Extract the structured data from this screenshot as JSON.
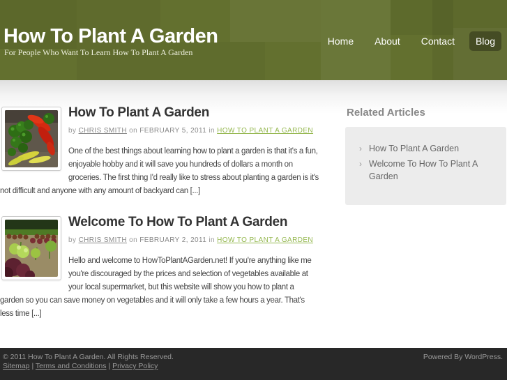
{
  "header": {
    "title": "How To Plant A Garden",
    "tagline": "For People Who Want To Learn How To Plant A Garden",
    "nav": [
      {
        "label": "Home",
        "active": false
      },
      {
        "label": "About",
        "active": false
      },
      {
        "label": "Contact",
        "active": false
      },
      {
        "label": "Blog",
        "active": true
      }
    ]
  },
  "posts": [
    {
      "title": "How To Plant A Garden",
      "thumbnail_name": "peppers-photo",
      "byline": {
        "by": "by",
        "author": "CHRIS SMITH",
        "on": "on",
        "date": "FEBRUARY 5, 2011",
        "in": "in",
        "category": "HOW TO PLANT A GARDEN"
      },
      "excerpt": "One of the best things about learning how to plant a garden is that it's a fun, enjoyable hobby and it will save you hundreds of dollars a month on groceries. The first thing I'd really like to stress about planting a garden is it's not difficult and anyone with any amount of backyard can [...]"
    },
    {
      "title": "Welcome To How To Plant A Garden",
      "thumbnail_name": "garden-rows-photo",
      "byline": {
        "by": "by",
        "author": "CHRIS SMITH",
        "on": "on",
        "date": "FEBRUARY 2, 2011",
        "in": "in",
        "category": "HOW TO PLANT A GARDEN"
      },
      "excerpt": "Hello and welcome to HowToPlantAGarden.net! If you're anything like me you're discouraged by the prices and selection of vegetables available at your local supermarket, but this website will show you how to plant a garden so you can save money on vegetables and it will only take a few hours a year. That's less time [...]"
    }
  ],
  "sidebar": {
    "heading": "Related Articles",
    "bullet_glyph": "›",
    "items": [
      "How To Plant A Garden",
      "Welcome To How To Plant A Garden"
    ]
  },
  "footer": {
    "copyright": "© 2011 How To Plant A Garden. All Rights Reserved.",
    "links": [
      "Sitemap",
      "Terms and Conditions",
      "Privacy Policy"
    ],
    "separator": "|",
    "powered_by": "Powered By WordPress."
  },
  "colors": {
    "header_green": "#63702f",
    "nav_active_pill": "rgba(0,0,0,0.30)",
    "category_link_green": "#94b74e",
    "footer_bg": "#282828",
    "footer_text": "#999999"
  }
}
